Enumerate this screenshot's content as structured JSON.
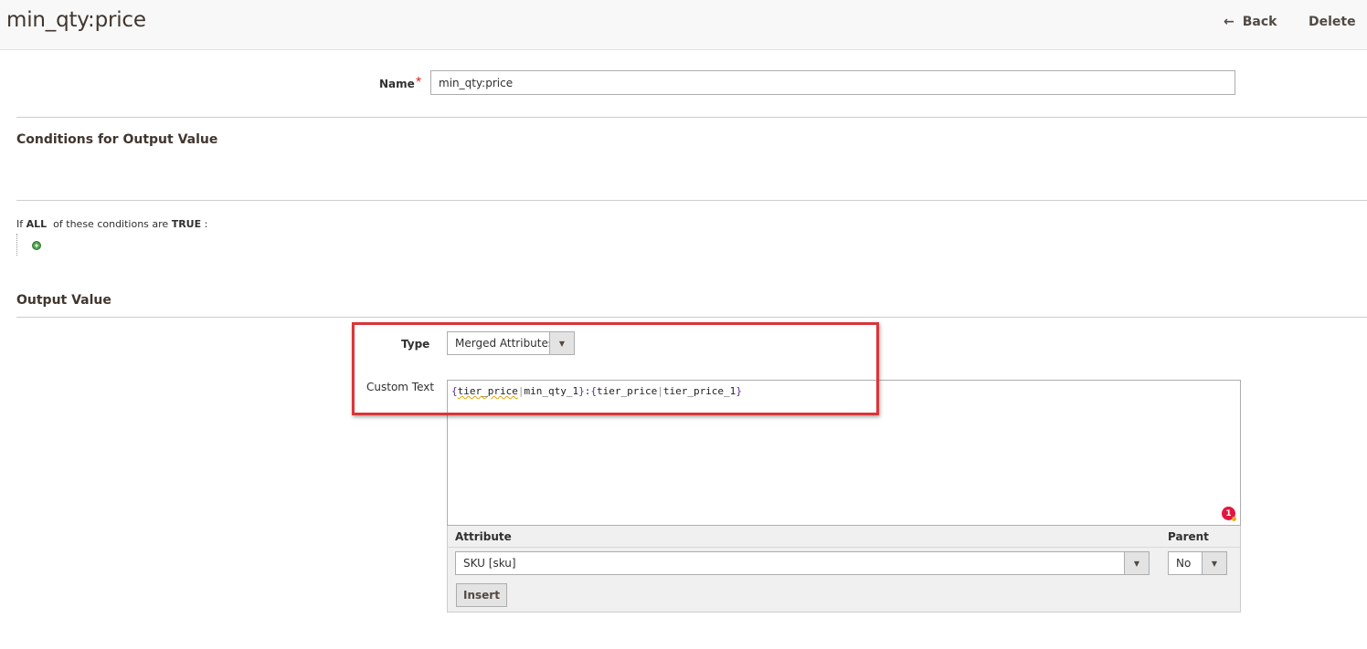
{
  "header": {
    "title": "min_qty:price",
    "back_label": "Back",
    "delete_label": "Delete"
  },
  "name_field": {
    "label": "Name",
    "required_mark": "*",
    "value": "min_qty:price"
  },
  "conditions": {
    "section_title": "Conditions for Output Value",
    "prefix": "If",
    "aggregator": "ALL",
    "middle": "of these conditions are",
    "value": "TRUE",
    "suffix": ":"
  },
  "output": {
    "section_title": "Output Value",
    "type_label": "Type",
    "type_value": "Merged Attributes",
    "custom_text_label": "Custom Text",
    "custom_text": {
      "open1": "{",
      "attr1": "tier_price",
      "pipe1": "|",
      "key1": "min_qty_1",
      "close1": "}",
      "sep": ":",
      "open2": "{",
      "attr2": "tier_price",
      "pipe2": "|",
      "key2": "tier_price_1",
      "close2": "}"
    },
    "error_count": "1"
  },
  "insert_panel": {
    "attribute_label": "Attribute",
    "attribute_value": "SKU [sku]",
    "parent_label": "Parent",
    "parent_value": "No",
    "insert_label": "Insert"
  }
}
